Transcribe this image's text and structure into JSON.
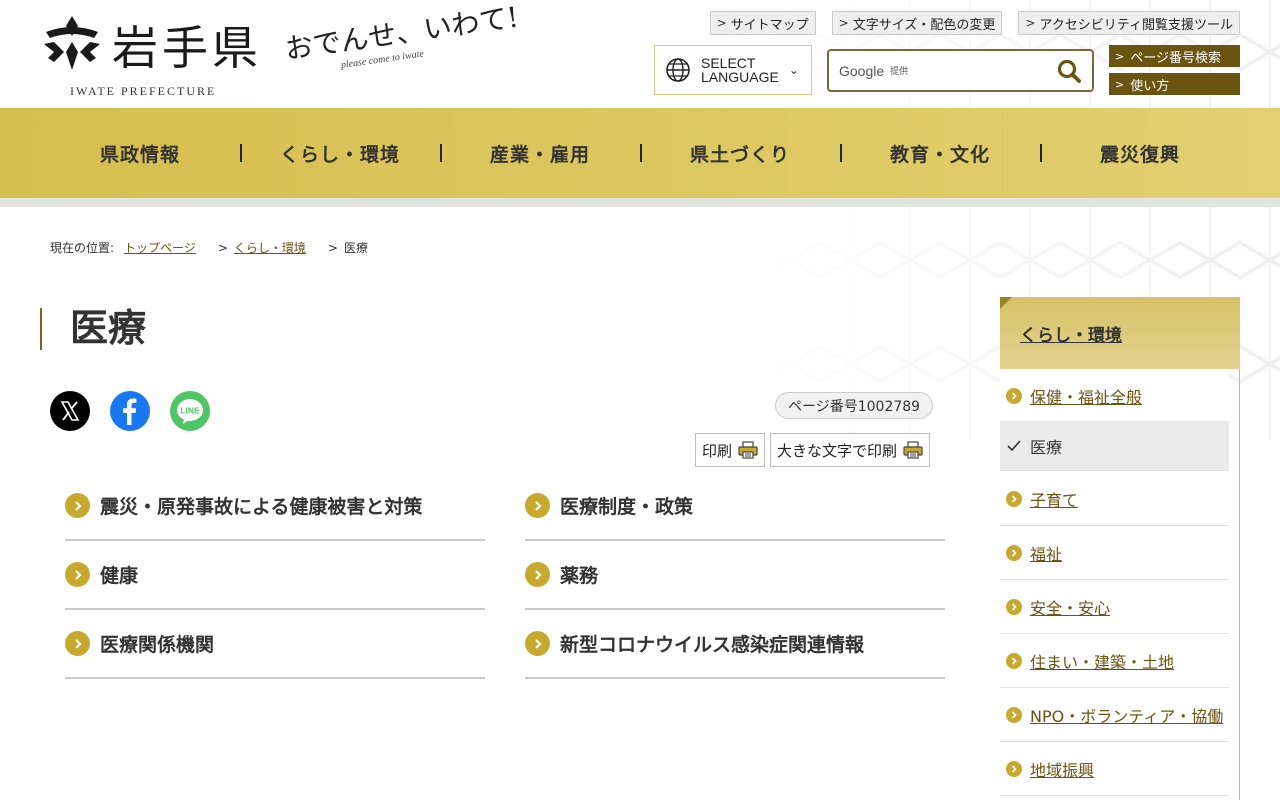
{
  "header": {
    "logo_title": "岩手県",
    "logo_en": "IWATE PREFECTURE",
    "slogan_jp": "おでんせ、いわて!",
    "slogan_en": "please come to iwate",
    "top_links": [
      "サイトマップ",
      "文字サイズ・配色の変更",
      "アクセシビリティ閲覧支援ツール"
    ],
    "language": {
      "line1": "SELECT",
      "line2": "LANGUAGE"
    },
    "search": {
      "brand": "Google",
      "provided": "提供"
    },
    "page_number_search": "ページ番号検索",
    "how_to_use": "使い方"
  },
  "nav": [
    "県政情報",
    "くらし・環境",
    "産業・雇用",
    "県土づくり",
    "教育・文化",
    "震災復興"
  ],
  "breadcrumb": {
    "label": "現在の位置:",
    "items": [
      "トップページ",
      "くらし・環境",
      "医療"
    ]
  },
  "main": {
    "title": "医療",
    "share": [
      "x-icon",
      "facebook-icon",
      "line-icon"
    ],
    "line_text": "LINE",
    "page_number": "ページ番号1002789",
    "print": "印刷",
    "print_large": "大きな文字で印刷",
    "categories": [
      "震災・原発事故による健康被害と対策",
      "医療制度・政策",
      "健康",
      "薬務",
      "医療関係機関",
      "新型コロナウイルス感染症関連情報"
    ]
  },
  "sidebar": {
    "heading": "くらし・環境",
    "items": [
      "保健・福祉全般",
      "医療",
      "子育て",
      "福祉",
      "安全・安心",
      "住まい・建築・土地",
      "NPO・ボランティア・協働",
      "地域振興"
    ],
    "active_index": 1
  },
  "colors": {
    "accent_gold": "#d6bf4e",
    "dark_brown": "#6b5310",
    "bullet_gold": "#c7a92e"
  }
}
